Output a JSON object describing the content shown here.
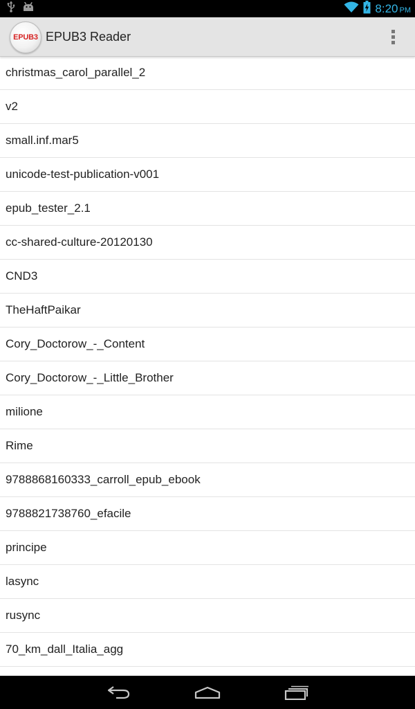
{
  "status_bar": {
    "time": "8:20",
    "ampm": "PM",
    "icons": [
      "usb-icon",
      "android-debug-icon",
      "wifi-icon",
      "battery-charging-icon"
    ]
  },
  "action_bar": {
    "logo_text": "EPUB3",
    "title": "EPUB3 Reader",
    "overflow_icon": "overflow-menu-icon"
  },
  "books": [
    "christmas_carol_parallel_2",
    "v2",
    "small.inf.mar5",
    "unicode-test-publication-v001",
    "epub_tester_2.1",
    "cc-shared-culture-20120130",
    "CND3",
    "TheHaftPaikar",
    "Cory_Doctorow_-_Content",
    "Cory_Doctorow_-_Little_Brother",
    "milione",
    "Rime",
    "9788868160333_carroll_epub_ebook",
    "9788821738760_efacile",
    "principe",
    "lasync",
    "rusync",
    "70_km_dall_Italia_agg"
  ],
  "nav_bar": {
    "icons": [
      "back-icon",
      "home-icon",
      "recents-icon"
    ]
  },
  "colors": {
    "status_accent": "#33b5e5",
    "action_bar_bg": "#e4e4e4",
    "logo_text": "#d62424"
  }
}
